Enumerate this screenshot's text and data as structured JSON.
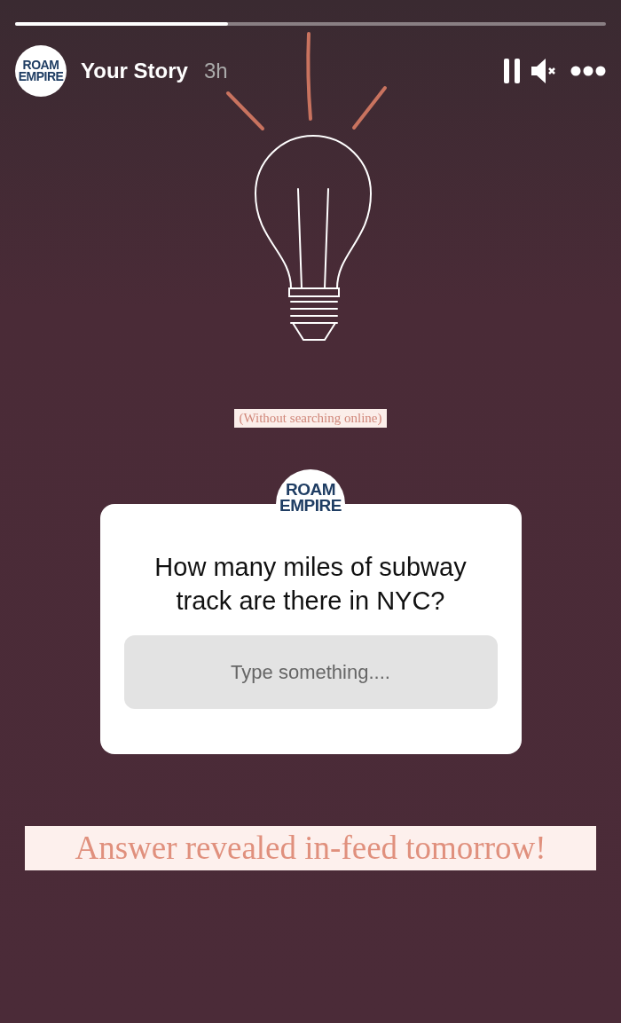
{
  "progress": {
    "level": 0.36
  },
  "header": {
    "avatar_logo": [
      "ROAM",
      "EMPIRE"
    ],
    "title": "Your Story",
    "time": "3h"
  },
  "caption": "(Without searching online)",
  "question_sticker": {
    "logo": [
      "ROAM",
      "EMPIRE"
    ],
    "question": "How many miles of subway track are there in NYC?",
    "placeholder": "Type something...."
  },
  "footer_text": "Answer revealed in-feed tomorrow!"
}
